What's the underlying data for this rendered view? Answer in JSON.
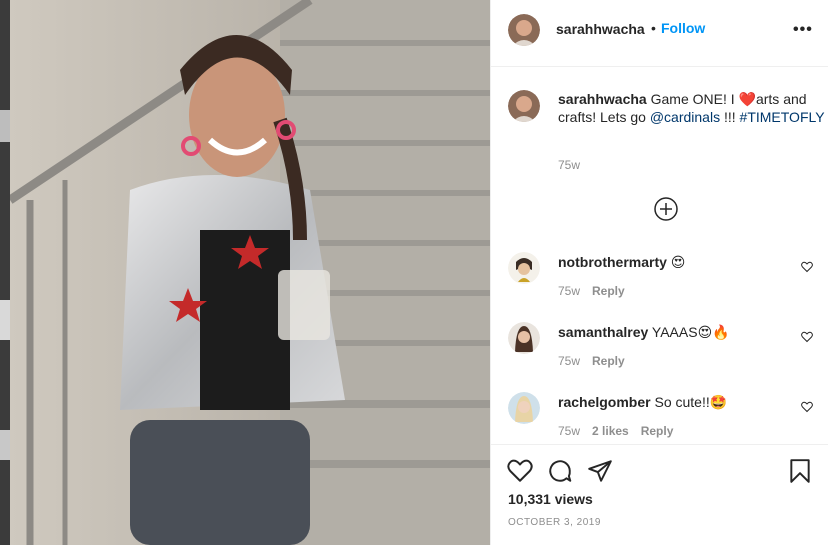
{
  "post": {
    "author": "sarahhwacha",
    "follow_label": "Follow",
    "separator": "•",
    "more_label": "•••",
    "caption": {
      "username": "sarahhwacha",
      "text_before": "Game ONE! I ",
      "emoji_heart": "❤️",
      "text_mid": "arts and crafts! Lets go ",
      "mention": "@cardinals",
      "text_after": " !!! ",
      "hashtag": "#TIMETOFLY",
      "time": "75w"
    },
    "comments": [
      {
        "username": "notbrothermarty",
        "text": "😍",
        "time": "75w",
        "likes": "",
        "reply": "Reply"
      },
      {
        "username": "samanthalrey",
        "text": "YAAAS😍🔥",
        "time": "75w",
        "likes": "",
        "reply": "Reply"
      },
      {
        "username": "rachelgomber",
        "text": "So cute!!🤩",
        "time": "75w",
        "likes": "2 likes",
        "reply": "Reply"
      }
    ],
    "views": "10,331 views",
    "date": "OCTOBER 3, 2019"
  },
  "icons": {
    "more": "more-options-icon",
    "load_more": "plus-circle-icon",
    "like": "heart-icon",
    "comment": "comment-icon",
    "share": "share-icon",
    "save": "bookmark-icon"
  },
  "colors": {
    "follow": "#0095f6",
    "link": "#00376b",
    "muted": "#8e8e8e",
    "text": "#262626"
  }
}
